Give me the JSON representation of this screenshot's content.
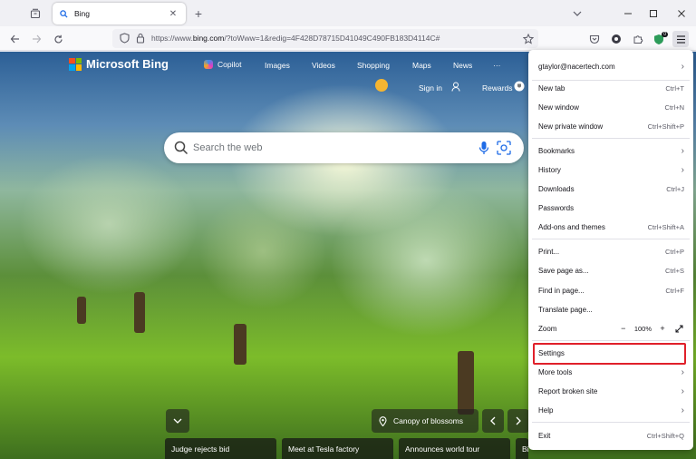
{
  "tab": {
    "title": "Bing"
  },
  "urlbar": {
    "prefix": "https://www.",
    "host": "bing.com",
    "path": "/?toWww=1&redig=4F428D78715D41049C490FB183D4114C#"
  },
  "toolbar": {
    "badge": "0"
  },
  "bing": {
    "brand": "Microsoft Bing",
    "nav": [
      "Copilot",
      "Images",
      "Videos",
      "Shopping",
      "Maps",
      "News",
      "···"
    ],
    "sign_in": "Sign in",
    "rewards": "Rewards",
    "search_placeholder": "Search the web",
    "caption": "Canopy of blossoms",
    "news": [
      "Judge rejects bid",
      "Meet at Tesla factory",
      "Announces world tour",
      "Bid"
    ]
  },
  "menu": {
    "account": "gtaylor@nacertech.com",
    "items": [
      {
        "label": "New tab",
        "shortcut": "Ctrl+T"
      },
      {
        "label": "New window",
        "shortcut": "Ctrl+N"
      },
      {
        "label": "New private window",
        "shortcut": "Ctrl+Shift+P"
      },
      {
        "label": "Bookmarks",
        "shortcut": ""
      },
      {
        "label": "History",
        "shortcut": ""
      },
      {
        "label": "Downloads",
        "shortcut": "Ctrl+J"
      },
      {
        "label": "Passwords",
        "shortcut": ""
      },
      {
        "label": "Add-ons and themes",
        "shortcut": "Ctrl+Shift+A"
      },
      {
        "label": "Print...",
        "shortcut": "Ctrl+P"
      },
      {
        "label": "Save page as...",
        "shortcut": "Ctrl+S"
      },
      {
        "label": "Find in page...",
        "shortcut": "Ctrl+F"
      },
      {
        "label": "Translate page...",
        "shortcut": ""
      },
      {
        "label": "Zoom",
        "shortcut": ""
      },
      {
        "label": "Settings",
        "shortcut": ""
      },
      {
        "label": "More tools",
        "shortcut": ""
      },
      {
        "label": "Report broken site",
        "shortcut": ""
      },
      {
        "label": "Help",
        "shortcut": ""
      },
      {
        "label": "Exit",
        "shortcut": "Ctrl+Shift+Q"
      }
    ],
    "zoom_value": "100%",
    "zoom_minus": "−",
    "zoom_plus": "+"
  },
  "colors": {
    "highlight": "#e0202a",
    "accent": "#1e6be6"
  }
}
